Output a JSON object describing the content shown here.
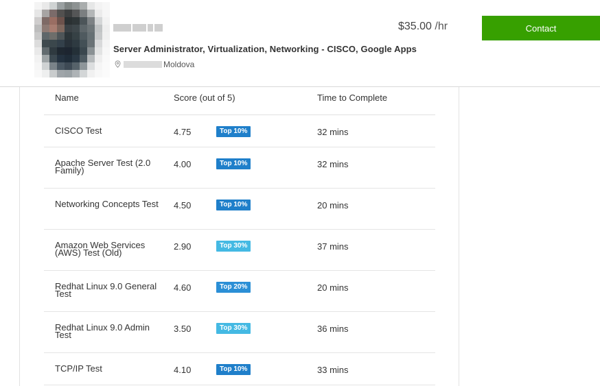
{
  "profile": {
    "title": "Server Administrator, Virtualization, Networking - CISCO, Google Apps",
    "location": "Moldova",
    "rate": "$35.00",
    "rate_unit": " /hr",
    "contact_label": "Contact",
    "icons": {
      "location": "location-pin-icon"
    }
  },
  "tests": {
    "columns": [
      "Name",
      "Score (out of 5)",
      "Time to Complete"
    ],
    "rows": [
      {
        "name": "CISCO Test",
        "score": "4.75",
        "badge": "Top 10%",
        "time": "32 mins"
      },
      {
        "name": "Apache Server Test (2.0 Family)",
        "score": "4.00",
        "badge": "Top 10%",
        "time": "32 mins"
      },
      {
        "name": "Networking Concepts Test",
        "score": "4.50",
        "badge": "Top 10%",
        "time": "20 mins"
      },
      {
        "name": "Amazon Web Services (AWS) Test (Old)",
        "score": "2.90",
        "badge": "Top 30%",
        "time": "37 mins"
      },
      {
        "name": "Redhat Linux 9.0 General Test",
        "score": "4.60",
        "badge": "Top 20%",
        "time": "20 mins"
      },
      {
        "name": "Redhat Linux 9.0 Admin Test",
        "score": "3.50",
        "badge": "Top 30%",
        "time": "36 mins"
      },
      {
        "name": "TCP/IP Test",
        "score": "4.10",
        "badge": "Top 10%",
        "time": "33 mins"
      }
    ]
  },
  "colors": {
    "contact_button": "#37a000",
    "badge_top10": "#1f7fca",
    "badge_top20": "#2b8fd6",
    "badge_top30": "#44b9e3"
  }
}
